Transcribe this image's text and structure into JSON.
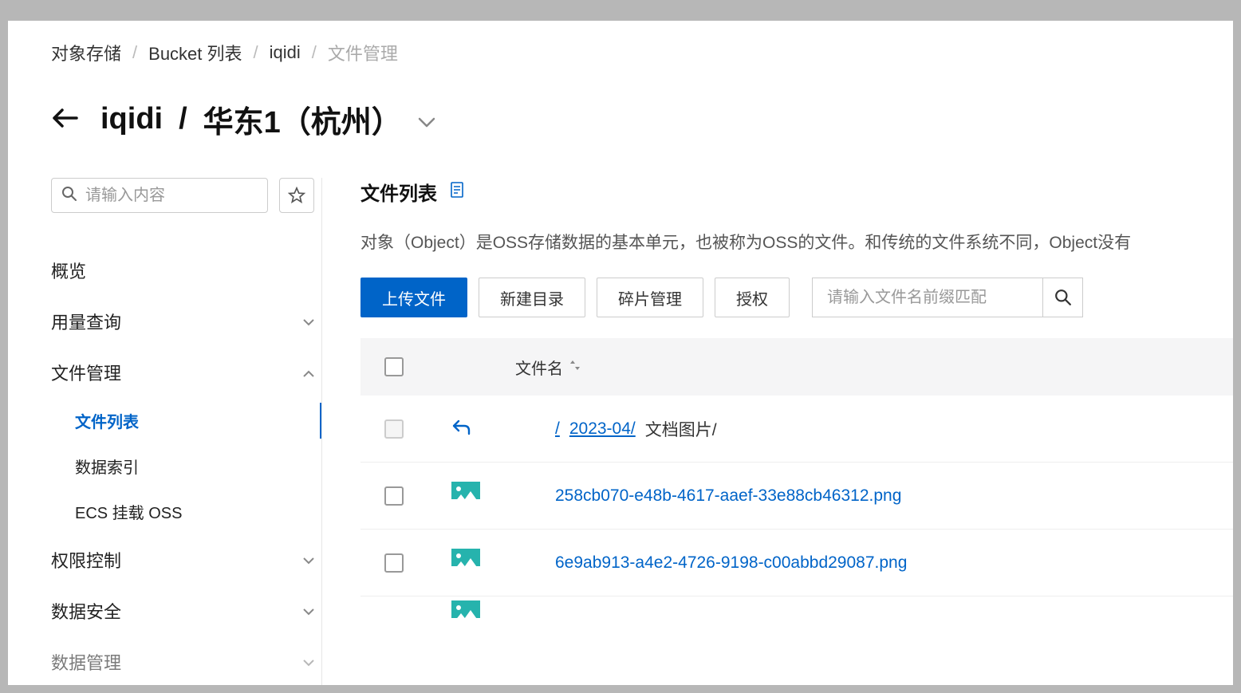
{
  "breadcrumb": {
    "items": [
      "对象存储",
      "Bucket 列表",
      "iqidi",
      "文件管理"
    ]
  },
  "header": {
    "back_aria": "返回",
    "title_bucket": "iqidi",
    "title_region": "华东1（杭州）"
  },
  "sidebar": {
    "search_placeholder": "请输入内容",
    "items": [
      {
        "label": "概览",
        "expandable": false
      },
      {
        "label": "用量查询",
        "expandable": true,
        "expanded": false
      },
      {
        "label": "文件管理",
        "expandable": true,
        "expanded": true,
        "children": [
          {
            "label": "文件列表",
            "active": true
          },
          {
            "label": "数据索引",
            "active": false
          },
          {
            "label": "ECS 挂载 OSS",
            "active": false
          }
        ]
      },
      {
        "label": "权限控制",
        "expandable": true,
        "expanded": false
      },
      {
        "label": "数据安全",
        "expandable": true,
        "expanded": false
      },
      {
        "label": "数据管理",
        "expandable": true,
        "expanded": false
      }
    ]
  },
  "main": {
    "title": "文件列表",
    "description": "对象（Object）是OSS存储数据的基本单元，也被称为OSS的文件。和传统的文件系统不同，Object没有",
    "buttons": {
      "upload": "上传文件",
      "new_dir": "新建目录",
      "fragment": "碎片管理",
      "auth": "授权"
    },
    "prefix_placeholder": "请输入文件名前缀匹配",
    "columns": {
      "filename": "文件名"
    },
    "path": {
      "root": "/",
      "parent": "2023-04/",
      "current": "文档图片/"
    },
    "files": [
      {
        "name": "258cb070-e48b-4617-aaef-33e88cb46312.png"
      },
      {
        "name": "6e9ab913-a4e2-4726-9198-c00abbd29087.png"
      }
    ]
  }
}
